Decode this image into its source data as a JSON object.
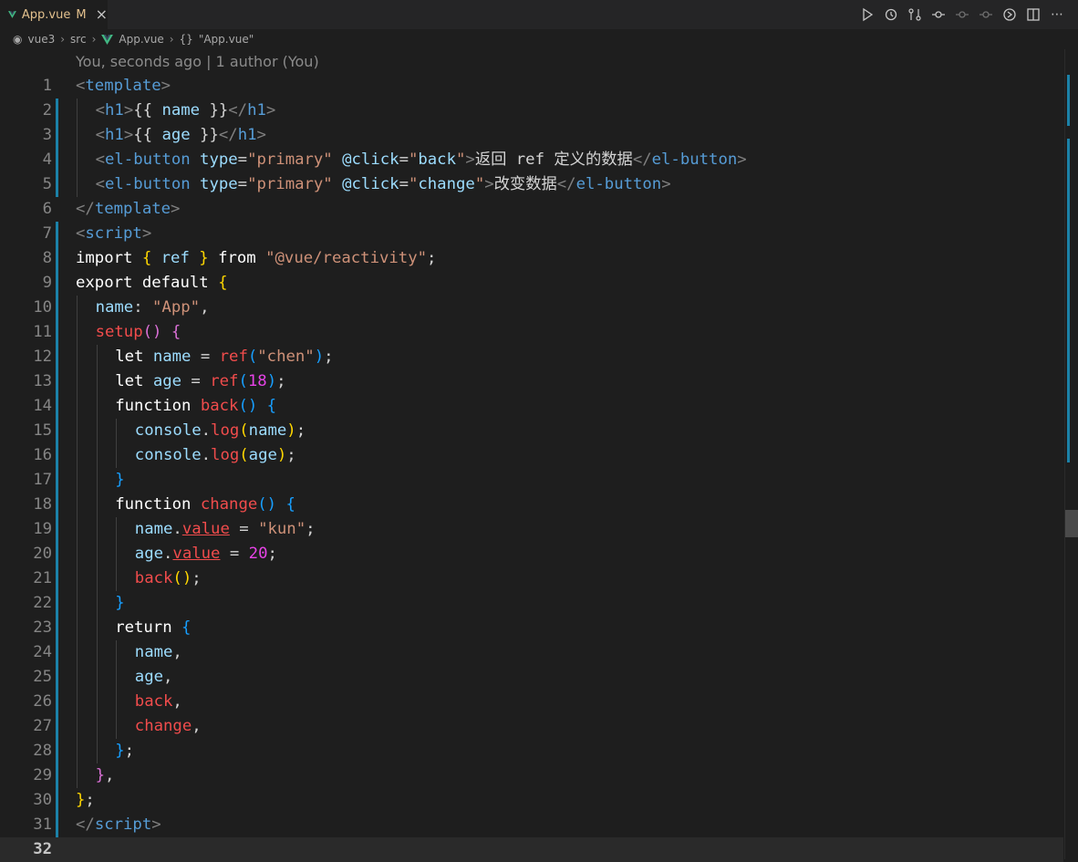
{
  "tab": {
    "name": "App.vue",
    "status": "M",
    "close": "×"
  },
  "breadcrumb": [
    {
      "icon": "◉",
      "label": "vue3"
    },
    {
      "icon": "",
      "label": "src"
    },
    {
      "icon": "vue",
      "label": "App.vue"
    },
    {
      "icon": "{}",
      "label": "\"App.vue\""
    }
  ],
  "blame": "You, seconds ago | 1 author (You)",
  "colors": {
    "accent": "#1b81a8",
    "tab_text": "#e2c08d",
    "vue_green": "#41b883"
  },
  "actions": [
    "run-icon",
    "timeline-icon",
    "compare-icon",
    "commit-icon",
    "prev-change-icon",
    "next-change-icon",
    "preview-icon",
    "split-editor-icon",
    "more-icon"
  ],
  "lines": [
    {
      "n": "1",
      "indent": 0,
      "mark": false,
      "tokens": [
        [
          "punc",
          "<"
        ],
        [
          "tag",
          "template"
        ],
        [
          "punc",
          ">"
        ]
      ]
    },
    {
      "n": "2",
      "indent": 1,
      "mark": true,
      "tokens": [
        [
          "punc",
          "<"
        ],
        [
          "tag",
          "h1"
        ],
        [
          "punc",
          ">"
        ],
        [
          "txt",
          "{{ "
        ],
        [
          "var",
          "name"
        ],
        [
          "txt",
          " }}"
        ],
        [
          "punc",
          "</"
        ],
        [
          "tag",
          "h1"
        ],
        [
          "punc",
          ">"
        ]
      ]
    },
    {
      "n": "3",
      "indent": 1,
      "mark": true,
      "tokens": [
        [
          "punc",
          "<"
        ],
        [
          "tag",
          "h1"
        ],
        [
          "punc",
          ">"
        ],
        [
          "txt",
          "{{ "
        ],
        [
          "var",
          "age"
        ],
        [
          "txt",
          " }}"
        ],
        [
          "punc",
          "</"
        ],
        [
          "tag",
          "h1"
        ],
        [
          "punc",
          ">"
        ]
      ]
    },
    {
      "n": "4",
      "indent": 1,
      "mark": true,
      "tokens": [
        [
          "punc",
          "<"
        ],
        [
          "tag",
          "el-button"
        ],
        [
          "txt",
          " "
        ],
        [
          "attr",
          "type"
        ],
        [
          "txt",
          "="
        ],
        [
          "str",
          "\"primary\""
        ],
        [
          "txt",
          " "
        ],
        [
          "attr",
          "@click"
        ],
        [
          "txt",
          "="
        ],
        [
          "str",
          "\""
        ],
        [
          "var",
          "back"
        ],
        [
          "str",
          "\""
        ],
        [
          "punc",
          ">"
        ],
        [
          "txt",
          "返回 ref 定义的数据"
        ],
        [
          "punc",
          "</"
        ],
        [
          "tag",
          "el-button"
        ],
        [
          "punc",
          ">"
        ]
      ]
    },
    {
      "n": "5",
      "indent": 1,
      "mark": true,
      "tokens": [
        [
          "punc",
          "<"
        ],
        [
          "tag",
          "el-button"
        ],
        [
          "txt",
          " "
        ],
        [
          "attr",
          "type"
        ],
        [
          "txt",
          "="
        ],
        [
          "str",
          "\"primary\""
        ],
        [
          "txt",
          " "
        ],
        [
          "attr",
          "@click"
        ],
        [
          "txt",
          "="
        ],
        [
          "str",
          "\""
        ],
        [
          "var",
          "change"
        ],
        [
          "str",
          "\""
        ],
        [
          "punc",
          ">"
        ],
        [
          "txt",
          "改变数据"
        ],
        [
          "punc",
          "</"
        ],
        [
          "tag",
          "el-button"
        ],
        [
          "punc",
          ">"
        ]
      ]
    },
    {
      "n": "6",
      "indent": 0,
      "mark": false,
      "tokens": [
        [
          "punc",
          "</"
        ],
        [
          "tag",
          "template"
        ],
        [
          "punc",
          ">"
        ]
      ]
    },
    {
      "n": "7",
      "indent": 0,
      "mark": true,
      "tokens": [
        [
          "punc",
          "<"
        ],
        [
          "tag",
          "script"
        ],
        [
          "punc",
          ">"
        ]
      ]
    },
    {
      "n": "8",
      "indent": 0,
      "mark": true,
      "tokens": [
        [
          "kw",
          "import"
        ],
        [
          "txt",
          " "
        ],
        [
          "b1",
          "{"
        ],
        [
          "txt",
          " "
        ],
        [
          "var",
          "ref"
        ],
        [
          "txt",
          " "
        ],
        [
          "b1",
          "}"
        ],
        [
          "txt",
          " "
        ],
        [
          "kw",
          "from"
        ],
        [
          "txt",
          " "
        ],
        [
          "str",
          "\"@vue/reactivity\""
        ],
        [
          "txt",
          ";"
        ]
      ]
    },
    {
      "n": "9",
      "indent": 0,
      "mark": true,
      "tokens": [
        [
          "kw",
          "export"
        ],
        [
          "txt",
          " "
        ],
        [
          "kw",
          "default"
        ],
        [
          "txt",
          " "
        ],
        [
          "b1",
          "{"
        ]
      ]
    },
    {
      "n": "10",
      "indent": 1,
      "mark": true,
      "tokens": [
        [
          "var",
          "name"
        ],
        [
          "txt",
          ": "
        ],
        [
          "str",
          "\"App\""
        ],
        [
          "txt",
          ","
        ]
      ]
    },
    {
      "n": "11",
      "indent": 1,
      "mark": true,
      "tokens": [
        [
          "fn",
          "setup"
        ],
        [
          "b2",
          "()"
        ],
        [
          "txt",
          " "
        ],
        [
          "b2",
          "{"
        ]
      ]
    },
    {
      "n": "12",
      "indent": 2,
      "mark": true,
      "tokens": [
        [
          "kw",
          "let"
        ],
        [
          "txt",
          " "
        ],
        [
          "var",
          "name"
        ],
        [
          "txt",
          " = "
        ],
        [
          "fn",
          "ref"
        ],
        [
          "b3",
          "("
        ],
        [
          "str",
          "\"chen\""
        ],
        [
          "b3",
          ")"
        ],
        [
          "txt",
          ";"
        ]
      ]
    },
    {
      "n": "13",
      "indent": 2,
      "mark": true,
      "tokens": [
        [
          "kw",
          "let"
        ],
        [
          "txt",
          " "
        ],
        [
          "var",
          "age"
        ],
        [
          "txt",
          " = "
        ],
        [
          "fn",
          "ref"
        ],
        [
          "b3",
          "("
        ],
        [
          "num",
          "18"
        ],
        [
          "b3",
          ")"
        ],
        [
          "txt",
          ";"
        ]
      ]
    },
    {
      "n": "14",
      "indent": 2,
      "mark": true,
      "tokens": [
        [
          "kw",
          "function"
        ],
        [
          "txt",
          " "
        ],
        [
          "fn",
          "back"
        ],
        [
          "b3",
          "()"
        ],
        [
          "txt",
          " "
        ],
        [
          "b3",
          "{"
        ]
      ]
    },
    {
      "n": "15",
      "indent": 3,
      "mark": true,
      "tokens": [
        [
          "var",
          "console"
        ],
        [
          "txt",
          "."
        ],
        [
          "fn",
          "log"
        ],
        [
          "b1",
          "("
        ],
        [
          "var",
          "name"
        ],
        [
          "b1",
          ")"
        ],
        [
          "txt",
          ";"
        ]
      ]
    },
    {
      "n": "16",
      "indent": 3,
      "mark": true,
      "tokens": [
        [
          "var",
          "console"
        ],
        [
          "txt",
          "."
        ],
        [
          "fn",
          "log"
        ],
        [
          "b1",
          "("
        ],
        [
          "var",
          "age"
        ],
        [
          "b1",
          ")"
        ],
        [
          "txt",
          ";"
        ]
      ]
    },
    {
      "n": "17",
      "indent": 2,
      "mark": true,
      "tokens": [
        [
          "b3",
          "}"
        ]
      ]
    },
    {
      "n": "18",
      "indent": 2,
      "mark": true,
      "tokens": [
        [
          "kw",
          "function"
        ],
        [
          "txt",
          " "
        ],
        [
          "fn",
          "change"
        ],
        [
          "b3",
          "()"
        ],
        [
          "txt",
          " "
        ],
        [
          "b3",
          "{"
        ]
      ]
    },
    {
      "n": "19",
      "indent": 3,
      "mark": true,
      "tokens": [
        [
          "var",
          "name"
        ],
        [
          "txt",
          "."
        ],
        [
          "err",
          "value"
        ],
        [
          "txt",
          " = "
        ],
        [
          "str",
          "\"kun\""
        ],
        [
          "txt",
          ";"
        ]
      ]
    },
    {
      "n": "20",
      "indent": 3,
      "mark": true,
      "tokens": [
        [
          "var",
          "age"
        ],
        [
          "txt",
          "."
        ],
        [
          "err",
          "value"
        ],
        [
          "txt",
          " = "
        ],
        [
          "num",
          "20"
        ],
        [
          "txt",
          ";"
        ]
      ]
    },
    {
      "n": "21",
      "indent": 3,
      "mark": true,
      "tokens": [
        [
          "fn",
          "back"
        ],
        [
          "b1",
          "()"
        ],
        [
          "txt",
          ";"
        ]
      ]
    },
    {
      "n": "22",
      "indent": 2,
      "mark": true,
      "tokens": [
        [
          "b3",
          "}"
        ]
      ]
    },
    {
      "n": "23",
      "indent": 2,
      "mark": true,
      "tokens": [
        [
          "kw",
          "return"
        ],
        [
          "txt",
          " "
        ],
        [
          "b3",
          "{"
        ]
      ]
    },
    {
      "n": "24",
      "indent": 3,
      "mark": true,
      "tokens": [
        [
          "var",
          "name"
        ],
        [
          "txt",
          ","
        ]
      ]
    },
    {
      "n": "25",
      "indent": 3,
      "mark": true,
      "tokens": [
        [
          "var",
          "age"
        ],
        [
          "txt",
          ","
        ]
      ]
    },
    {
      "n": "26",
      "indent": 3,
      "mark": true,
      "tokens": [
        [
          "fn",
          "back"
        ],
        [
          "txt",
          ","
        ]
      ]
    },
    {
      "n": "27",
      "indent": 3,
      "mark": true,
      "tokens": [
        [
          "fn",
          "change"
        ],
        [
          "txt",
          ","
        ]
      ]
    },
    {
      "n": "28",
      "indent": 2,
      "mark": true,
      "tokens": [
        [
          "b3",
          "}"
        ],
        [
          "txt",
          ";"
        ]
      ]
    },
    {
      "n": "29",
      "indent": 1,
      "mark": true,
      "tokens": [
        [
          "b2",
          "}"
        ],
        [
          "txt",
          ","
        ]
      ]
    },
    {
      "n": "30",
      "indent": 0,
      "mark": true,
      "tokens": [
        [
          "b1",
          "}"
        ],
        [
          "txt",
          ";"
        ]
      ]
    },
    {
      "n": "31",
      "indent": 0,
      "mark": true,
      "tokens": [
        [
          "punc",
          "</"
        ],
        [
          "tag",
          "script"
        ],
        [
          "punc",
          ">"
        ]
      ]
    },
    {
      "n": "32",
      "indent": 0,
      "mark": false,
      "current": true,
      "tokens": []
    }
  ]
}
